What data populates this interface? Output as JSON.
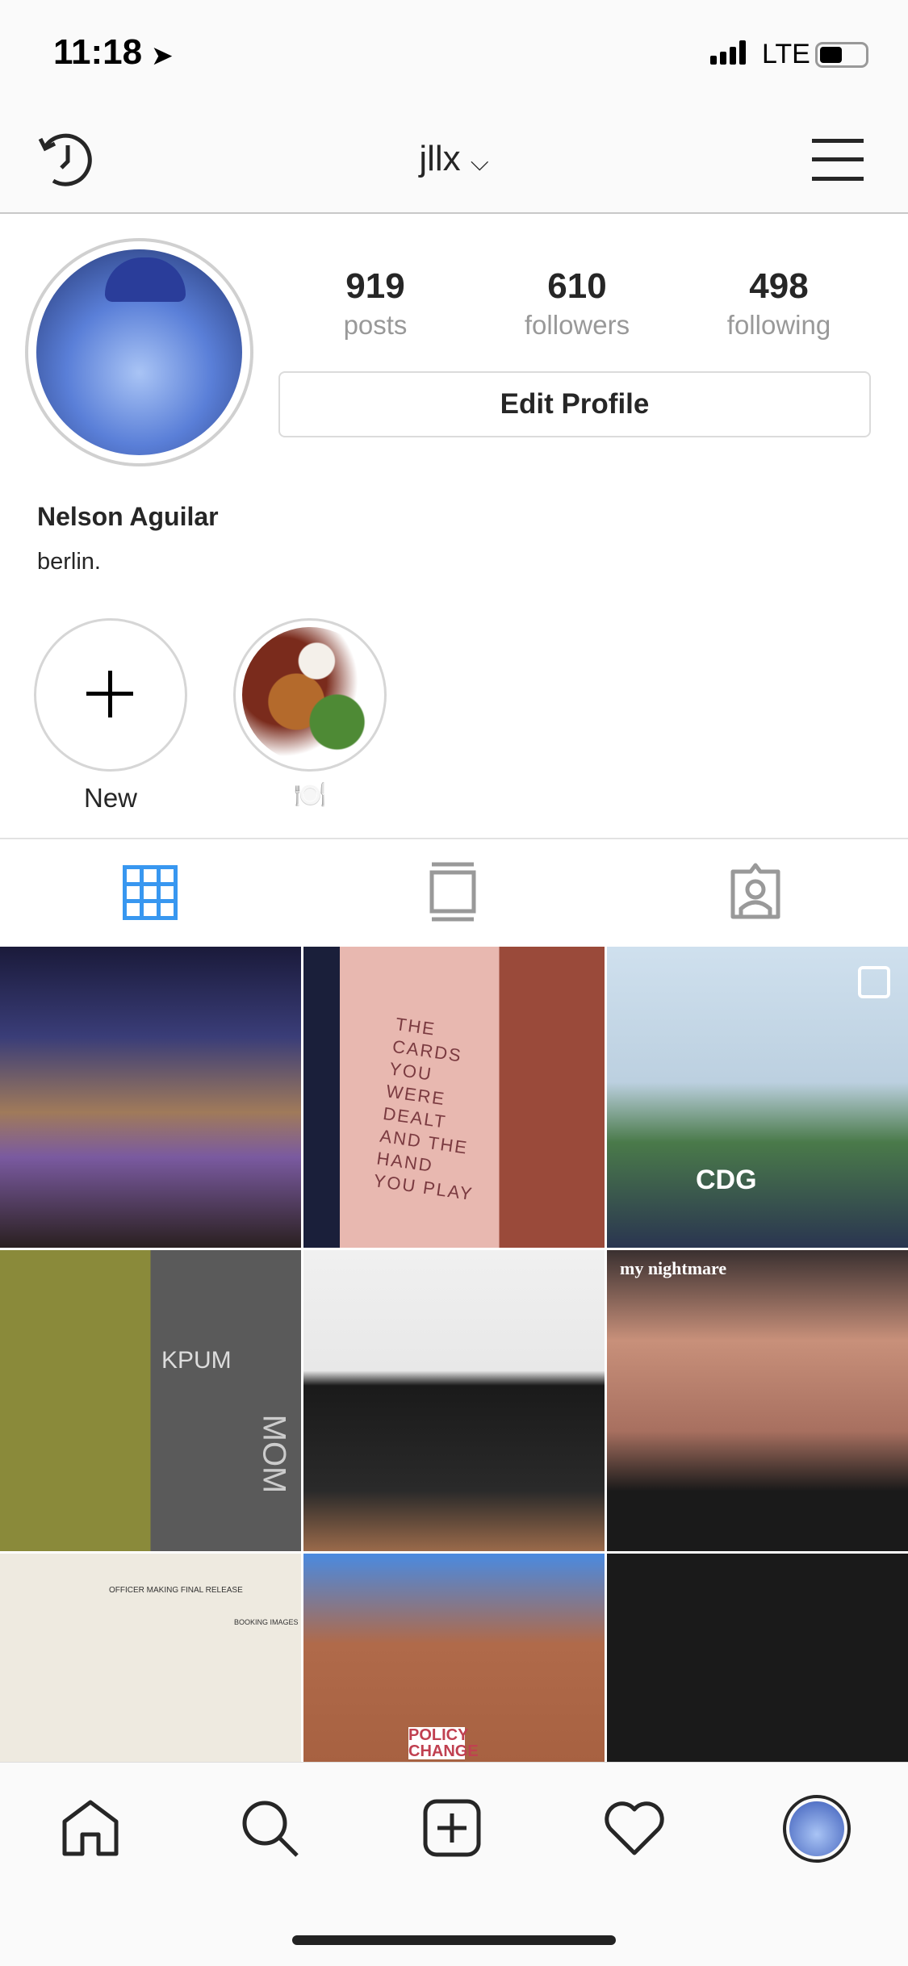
{
  "status_bar": {
    "time": "11:18",
    "network": "LTE",
    "signal_bars": 4,
    "battery_level": 0.5
  },
  "header": {
    "username": "jllx",
    "icons": {
      "left": "history-icon",
      "dropdown": "chevron-down-icon",
      "right": "menu-icon"
    }
  },
  "profile": {
    "stats": [
      {
        "value": "919",
        "label": "posts"
      },
      {
        "value": "610",
        "label": "followers"
      },
      {
        "value": "498",
        "label": "following"
      }
    ],
    "edit_label": "Edit Profile",
    "name": "Nelson Aguilar",
    "bio": "berlin."
  },
  "highlights": [
    {
      "label": "New",
      "icon": "plus-icon"
    },
    {
      "label": "🍽️",
      "icon": "food-highlight"
    }
  ],
  "tabs": [
    {
      "name": "grid",
      "icon": "grid-icon",
      "active": true
    },
    {
      "name": "igtv",
      "icon": "igtv-icon"
    },
    {
      "name": "tagged",
      "icon": "tagged-icon"
    }
  ],
  "grid_texts": {
    "tattoo": "THE CARDS YOU WERE DEALT AND THE HAND YOU PLAY",
    "nightmare": "my nightmare",
    "shirt": "CDG",
    "booking": "OFFICER MAKING FINAL RELEASE",
    "booking2": "BOOKING IMAGES",
    "policy": "POLICY CHANGE",
    "kpum": "KPUM",
    "mom": "MOM"
  },
  "colors": {
    "accent": "#3897f0",
    "text": "#262626",
    "muted": "#999999"
  },
  "bottom_nav": [
    {
      "icon": "home-icon"
    },
    {
      "icon": "search-icon"
    },
    {
      "icon": "add-post-icon"
    },
    {
      "icon": "heart-icon"
    },
    {
      "icon": "profile-avatar-icon"
    }
  ]
}
